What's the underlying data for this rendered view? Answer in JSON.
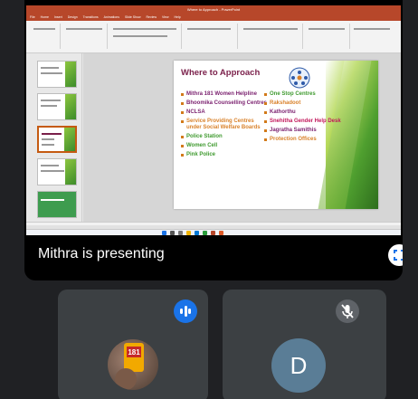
{
  "presentation": {
    "window_title": "Where to Approach - PowerPoint",
    "ribbon_tabs": [
      "File",
      "Home",
      "Insert",
      "Design",
      "Transitions",
      "Animations",
      "Slide Show",
      "Review",
      "View",
      "Help"
    ],
    "slide": {
      "title": "Where to Approach",
      "left_column": [
        "Mithra 181 Women Helpline",
        "Bhoomika Counselling Centres",
        "NCLSA",
        "Service Providing Centres under Social Welfare Boards",
        "Police Station",
        "Women Cell",
        "Pink Police"
      ],
      "right_column": [
        "One Stop Centres",
        "Rakshadoot",
        "Kathorthu",
        "Snehitha Gender Help Desk",
        "Jagratha Samithis",
        "Protection Offices"
      ]
    },
    "colors": {
      "title": "#7a1f4a",
      "left_items": [
        "#7a1f6e",
        "#7a1f6e",
        "#7a1f6e",
        "#d9822b",
        "#3f9a2f",
        "#3f9a2f",
        "#3f9a2f"
      ],
      "right_items": [
        "#3f9a2f",
        "#d9822b",
        "#7a1f6e",
        "#c2185b",
        "#7a1f6e",
        "#d9822b"
      ]
    }
  },
  "presenter": {
    "label": "Mithra is presenting"
  },
  "participants": [
    {
      "avatar": "photo-avatar",
      "speaking_indicator": "audio-wave-icon"
    },
    {
      "initial": "D",
      "status_icon": "mic-off-icon"
    }
  ],
  "accent_colors": {
    "speaking": "#1a73e8",
    "muted_badge": "#5f6368",
    "avatar_d": "#5a7d96"
  }
}
